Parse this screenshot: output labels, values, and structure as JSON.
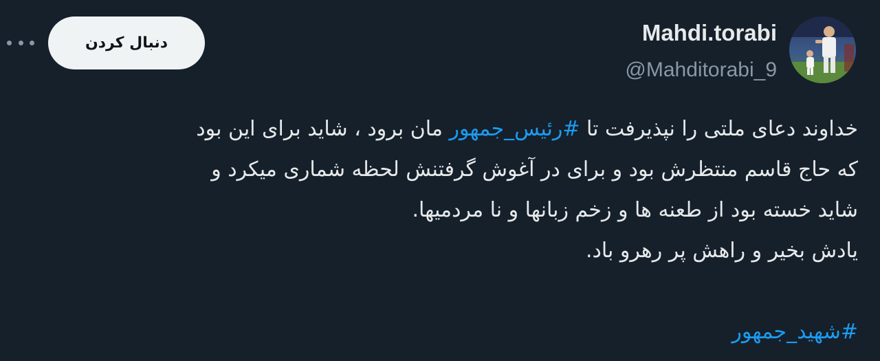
{
  "header": {
    "more_icon": "more-horizontal-icon",
    "follow_label": "دنبال کردن",
    "display_name": "Mahdi.torabi",
    "handle": "@Mahditorabi_9",
    "avatar_icon": "profile-photo"
  },
  "tweet": {
    "line1_before": "خداوند دعای ملتی را نپذیرفت تا ",
    "hashtag1": "#رئیس_جمهور",
    "line1_after": " مان برود ، شاید برای این بود",
    "line2": "که حاج قاسم منتظرش بود و برای در آغوش گرفتنش لحظه شماری میکرد و",
    "line3": "شاید خسته بود از طعنه ها و زخم زبانها و نا مردمیها.",
    "line4": "یادش بخیر و راهش پر رهرو باد.",
    "hashtag2": "#شهید_جمهور"
  },
  "colors": {
    "background": "#15202b",
    "text": "#e7e9ea",
    "secondary": "#8b98a5",
    "link": "#1d9bf0",
    "follow_bg": "#eff3f4"
  }
}
